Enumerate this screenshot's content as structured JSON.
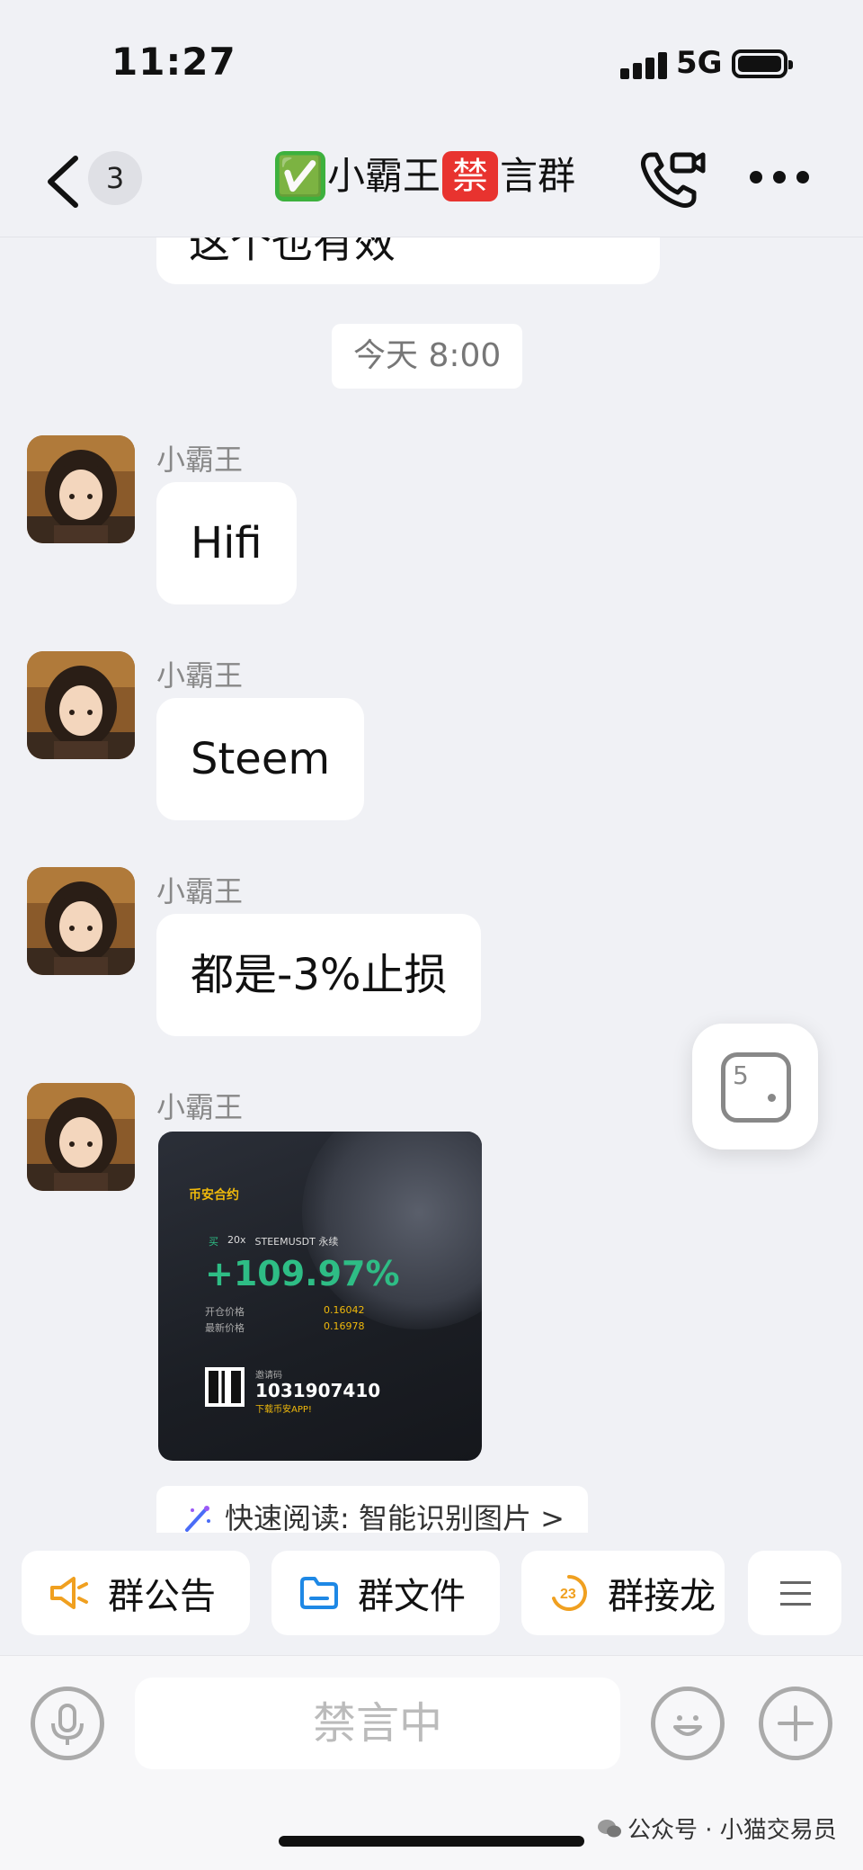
{
  "status_bar": {
    "time": "11:27",
    "network": "5G",
    "icons": [
      "signal-icon",
      "battery-icon"
    ]
  },
  "nav": {
    "back_icon": "chevron-left-icon",
    "unread_count": "3",
    "title_check": "✅",
    "title_part1": "小霸王",
    "title_ban": "禁",
    "title_part2": "言群",
    "call_icon": "video-call-icon",
    "more_icon": "more-icon"
  },
  "chat": {
    "partial_message": "这个也有效",
    "timestamp": "今天 8:00",
    "messages": [
      {
        "sender": "小霸王",
        "text": "Hifi"
      },
      {
        "sender": "小霸王",
        "text": "Steem"
      },
      {
        "sender": "小霸王",
        "text": "都是-3%止损"
      },
      {
        "sender": "小霸王",
        "type": "image"
      }
    ],
    "image_card": {
      "brand": "币安合约",
      "side": "买",
      "leverage": "20x",
      "symbol": "STEEMUSDT 永续",
      "pnl": "+109.97%",
      "open_label": "开仓价格",
      "open_value": "0.16042",
      "last_label": "最新价格",
      "last_value": "0.16978",
      "code_label": "邀请码",
      "code": "1031907410",
      "download": "下载币安APP!"
    },
    "quick_read": "快速阅读: 智能识别图片 >"
  },
  "floating_badge": {
    "count": "5"
  },
  "shortcuts": [
    {
      "label": "群公告",
      "icon": "megaphone-icon",
      "color": "#f0a020"
    },
    {
      "label": "群文件",
      "icon": "folder-icon",
      "color": "#1e88e5"
    },
    {
      "label": "群接龙",
      "icon": "relay-icon",
      "color": "#f0a020"
    }
  ],
  "input": {
    "placeholder": "禁言中",
    "voice_icon": "microphone-icon",
    "emoji_icon": "smiley-icon",
    "plus_icon": "plus-icon"
  },
  "watermark": "公众号 · 小猫交易员"
}
